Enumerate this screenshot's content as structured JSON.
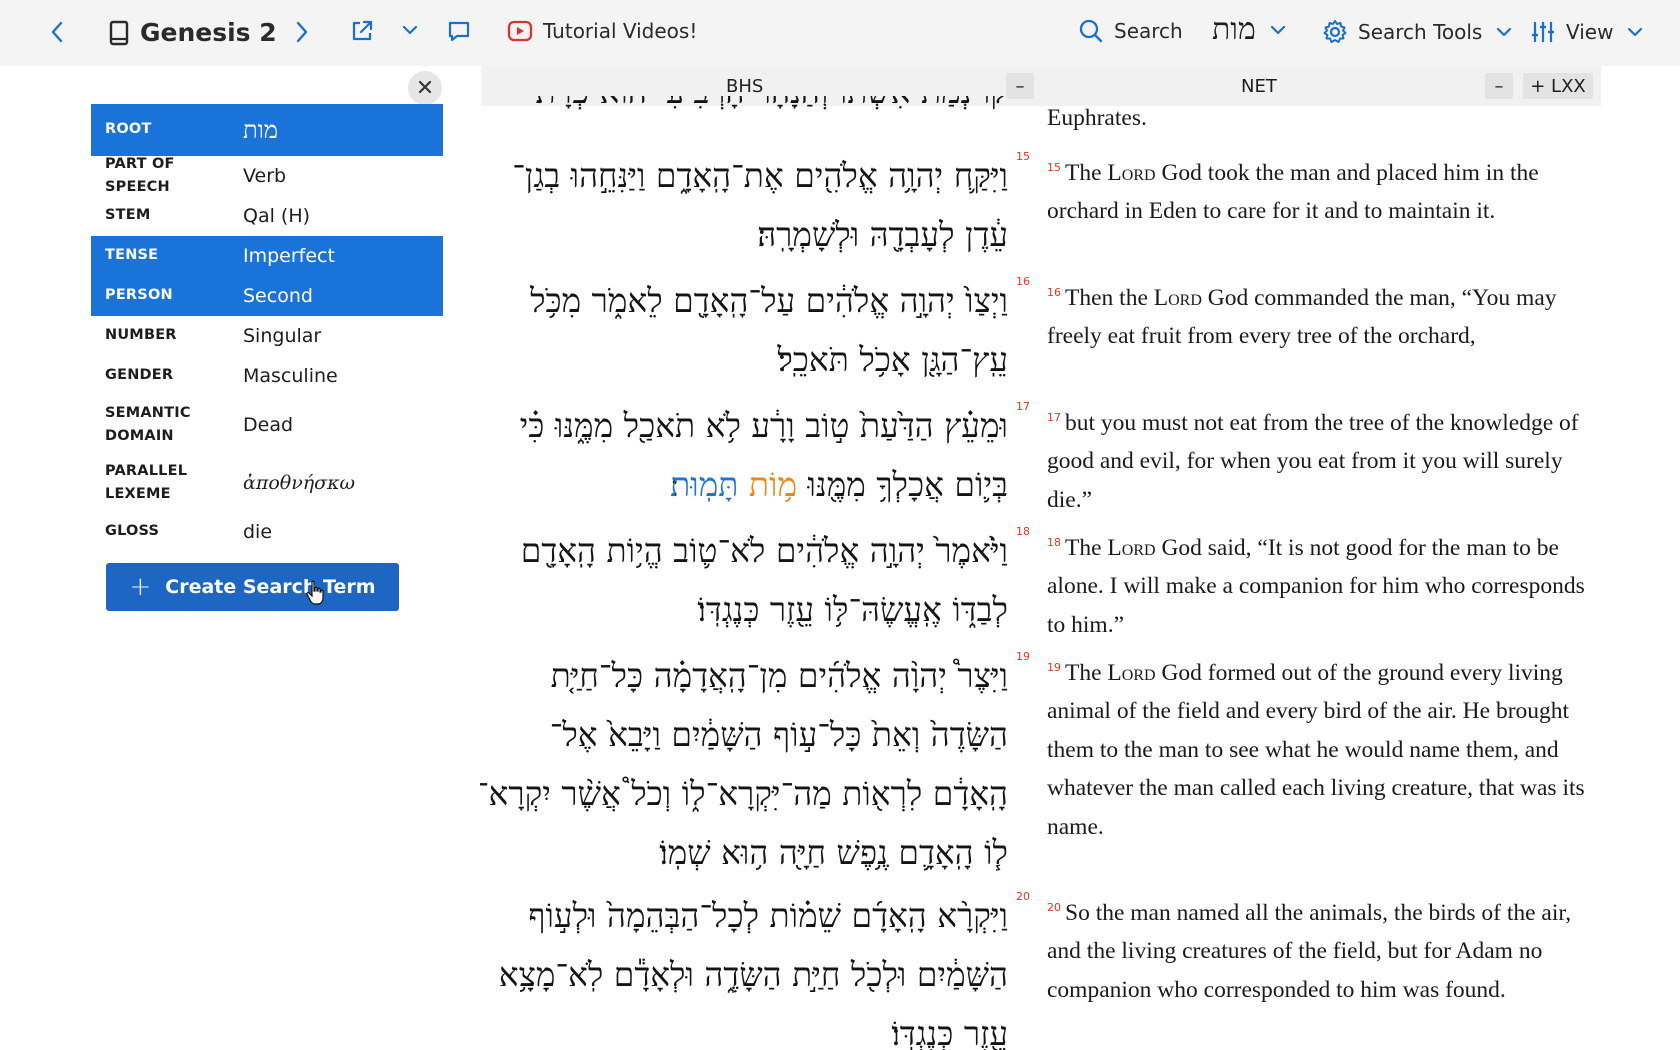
{
  "toolbar": {
    "book_title": "Genesis 2",
    "tutorial_label": "Tutorial Videos!",
    "search_label": "Search",
    "search_term": "מות",
    "search_tools_label": "Search Tools",
    "view_label": "View"
  },
  "word_info": {
    "rows": [
      {
        "label": "ROOT",
        "value": "מות",
        "selected": true
      },
      {
        "label": "PART OF SPEECH",
        "value": "Verb",
        "selected": false
      },
      {
        "label": "STEM",
        "value": "Qal (H)",
        "selected": false
      },
      {
        "label": "TENSE",
        "value": "Imperfect",
        "selected": true
      },
      {
        "label": "PERSON",
        "value": "Second",
        "selected": true
      },
      {
        "label": "NUMBER",
        "value": "Singular",
        "selected": false
      },
      {
        "label": "GENDER",
        "value": "Masculine",
        "selected": false
      },
      {
        "label": "SEMANTIC DOMAIN",
        "value": "Dead",
        "selected": false
      },
      {
        "label": "PARALLEL LEXEME",
        "value": "ἀποθνήσκω",
        "selected": false
      },
      {
        "label": "GLOSS",
        "value": "die",
        "selected": false
      }
    ],
    "create_button_label": "Create Search Term"
  },
  "columns": {
    "hebrew_title": "BHS",
    "hebrew_minus": "–",
    "english_title": "NET",
    "english_minus": "–",
    "lxx_label": "+ LXX"
  },
  "hebrew": {
    "partial_top": "קוֹ נְמַת אִשְׁתּוֹ וְהַנָּהָר הָרְבִיעִי הוּא פְרָת׃",
    "verses": [
      {
        "num": "15",
        "lines": [
          "וַיִּקַּ֛ח יְהוָ֥ה אֱלֹהִ֖ים אֶת־הָֽאָדָ֑ם וַיַּנִּחֵ֣הוּ בְגַן־",
          "עֵ֔דֶן לְעָבְדָ֖הּ וּלְשָׁמְרָֽהּ׃"
        ]
      },
      {
        "num": "16",
        "lines": [
          "וַיְצַו֙ יְהוָ֣ה אֱלֹהִ֔ים עַל־הָֽאָדָ֖ם לֵאמֹ֑ר מִכֹּ֥ל",
          "עֵֽץ־הַגָּ֖ן אָכֹ֥ל תֹּאכֵֽל׃"
        ]
      },
      {
        "num": "17",
        "lines": [
          "וּמֵעֵ֗ץ הַדַּ֙עַת֙ ט֣וֹב וָרָ֔ע לֹ֥א תֹאכַ֖ל מִמֶּ֑נּוּ כִּ֗י"
        ],
        "last_prefix": "בְּי֛וֹם אֲכָלְךָ֥ מִמֶּ֖נּוּ",
        "hl_orange": "מ֥וֹת",
        "hl_blue": "תָּמֽוּת",
        "last_suffix": "׃"
      },
      {
        "num": "18",
        "lines": [
          "וַיֹּ֙אמֶר֙ יְהוָ֣ה אֱלֹהִ֔ים לֹא־ט֛וֹב הֱי֥וֹת הָֽאָדָ֖ם",
          "לְבַדּ֑וֹ אֶֽעֱשֶׂהּ־לּ֥וֹ עֵ֖זֶר כְּנֶגְדּֽוֹ׃"
        ]
      },
      {
        "num": "19",
        "lines": [
          "וַיִּצֶר֩ יְהוָ֨ה אֱלֹהִ֜ים מִן־הָֽאֲדָמָ֗ה כָּל־חַיַּ֤ת",
          "הַשָּׂדֶה֙ וְאֵת֙ כָּל־ע֣וֹף הַשָּׁמַ֔יִם וַיָּבֵא֙ אֶל־",
          "הָֽאָדָ֔ם לִרְא֖וֹת מַה־יִּקְרָא־ל֑וֹ וְכֹל֩ אֲשֶׁ֨ר יִקְרָא־",
          "ל֧וֹ הָֽאָדָ֛ם נֶ֥פֶשׁ חַיָּ֖ה ה֥וּא שְׁמֽוֹ׃"
        ]
      },
      {
        "num": "20",
        "lines": [
          "וַיִּקְרָ֨א הָֽאָדָ֜ם שֵׁמ֗וֹת לְכָל־הַבְּהֵמָה֙ וּלְע֣וֹף",
          "הַשָּׁמַ֔יִם וּלְכֹ֖ל חַיַּ֣ת הַשָּׂדֶ֑ה וּלְאָדָ֕ם לֹֽא־מָצָ֥א",
          "עֵ֖זֶר כְּנֶגְדּֽוֹ׃"
        ]
      }
    ]
  },
  "english": {
    "partial_top": "Euphrates.",
    "verses": [
      {
        "num": "15",
        "pre": "The ",
        "lord": "Lord",
        "post": " God took the man and placed him in the orchard in Eden to care for it and to maintain it."
      },
      {
        "num": "16",
        "pre": "Then the ",
        "lord": "Lord",
        "post": " God commanded the man, “You may freely eat fruit from every tree of the orchard,"
      },
      {
        "num": "17",
        "pre": "",
        "lord": "",
        "post": "but you must not eat from the tree of the knowledge of good and evil, for when you eat from it you will surely die.”"
      },
      {
        "num": "18",
        "pre": "The ",
        "lord": "Lord",
        "post": " God said, “It is not good for the man to be alone. I will make a companion for him who corresponds to him.”"
      },
      {
        "num": "19",
        "pre": "The ",
        "lord": "Lord",
        "post": " God formed out of the ground every living animal of the field and every bird of the air. He brought them to the man to see what he would name them, and whatever the man called each living creature, that was its name."
      },
      {
        "num": "20",
        "pre": "",
        "lord": "",
        "post": "So the man named all the animals, the birds of the air, and the living creatures of the field, but for Adam no companion who corresponded to him was found."
      }
    ]
  }
}
